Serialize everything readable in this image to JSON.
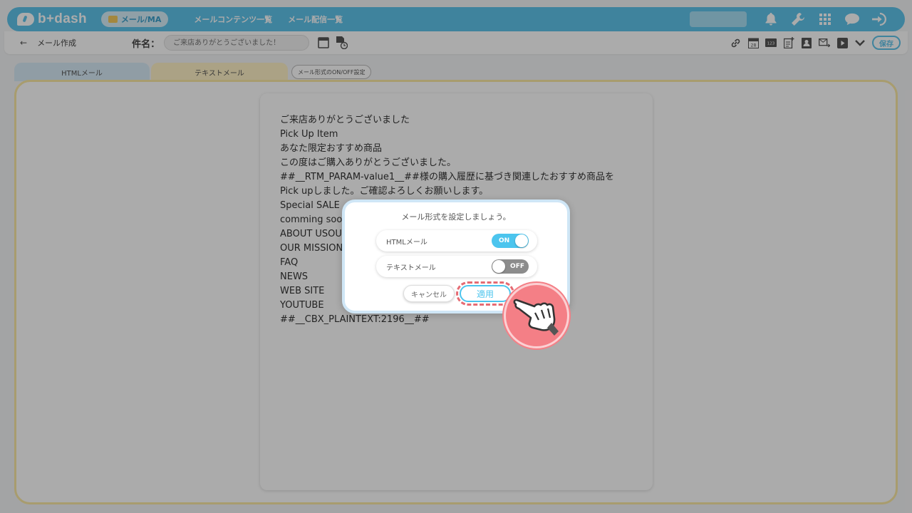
{
  "header": {
    "logo_text": "b+dash",
    "module_label": "メール/MA",
    "nav_links": [
      "メールコンテンツ一覧",
      "メール配信一覧"
    ]
  },
  "toolbar": {
    "page_title": "メール作成",
    "subject_label": "件名：",
    "subject_placeholder": "ご来店ありがとうございました！",
    "save_label": "保存"
  },
  "tabs": {
    "html_label": "HTMLメール",
    "text_label": "テキストメール",
    "format_button_label": "メール形式のON/OFF設定"
  },
  "editor": {
    "lines": [
      "ご来店ありがとうございました",
      "Pick Up Item",
      "あなた限定おすすめ商品",
      "この度はご購入ありがとうございました。",
      "##__RTM_PARAM-value1__##様の購入履歴に基づき関連したおすすめ商品を",
      "Pick upしました。ご確認よろしくお願いします。",
      "Special SALE",
      "comming soon",
      "ABOUT USOU",
      "OUR MISSION",
      "FAQ",
      "NEWS",
      "WEB SITE",
      "YOUTUBE",
      "##__CBX_PLAINTEXT:2196__##"
    ]
  },
  "modal": {
    "title": "メール形式を設定しましょう。",
    "options": [
      {
        "label": "HTMLメール",
        "state": "ON"
      },
      {
        "label": "テキストメール",
        "state": "OFF"
      }
    ],
    "cancel_label": "キャンセル",
    "apply_label": "適用"
  },
  "colors": {
    "brand": "#5fc3eb",
    "toggle_on": "#4cc5ee",
    "toggle_off": "#8c8c8c",
    "highlight": "#f47f86"
  },
  "icons": {
    "topbar": [
      "bell-icon",
      "wrench-icon",
      "apps-grid-icon",
      "chat-icon",
      "logout-icon"
    ],
    "toolbar": [
      "link-icon",
      "calendar-icon",
      "number-tag-icon",
      "add-document-icon",
      "contact-card-icon",
      "mail-forward-icon",
      "play-icon",
      "chevron-down-icon"
    ]
  }
}
